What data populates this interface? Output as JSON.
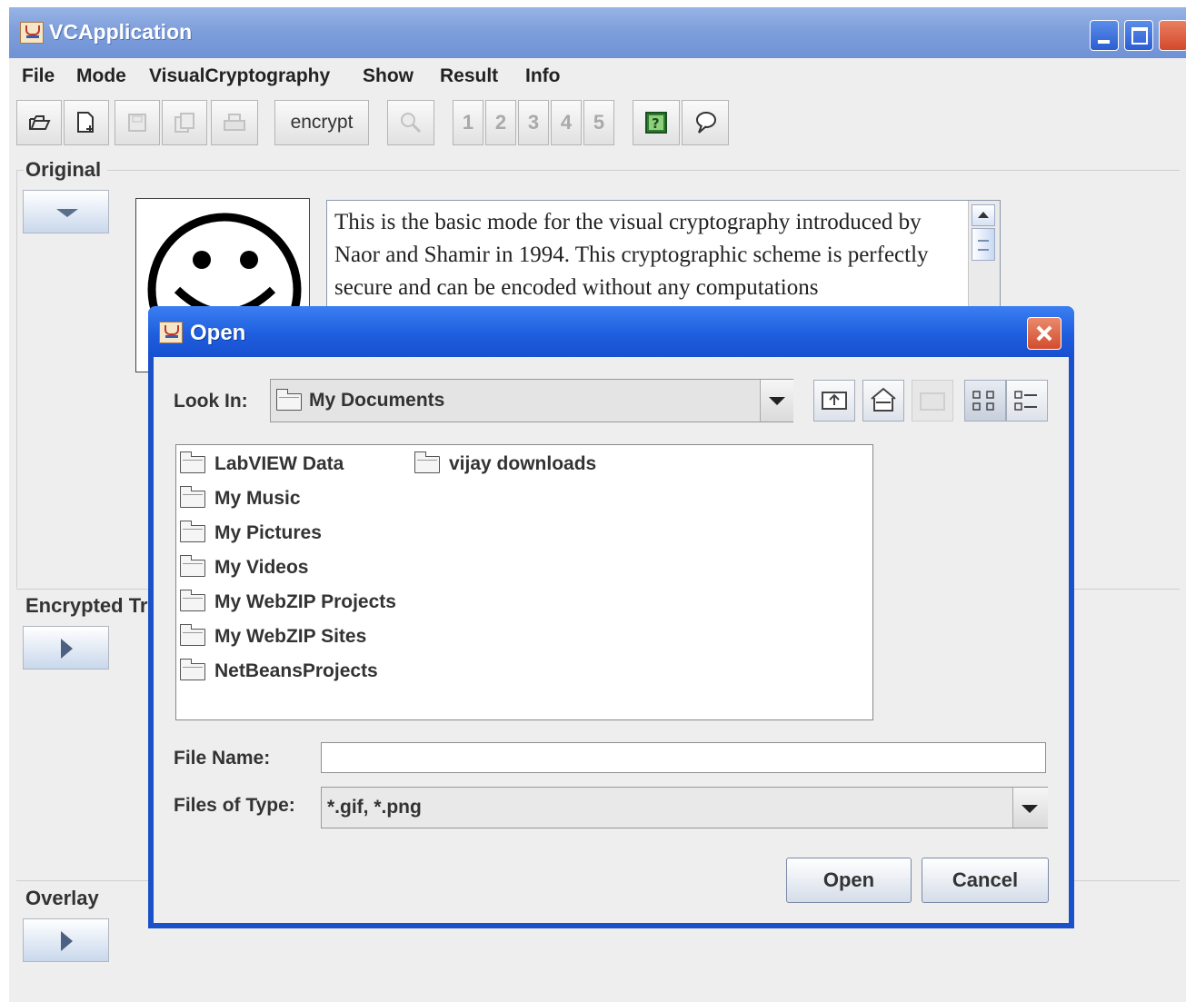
{
  "app": {
    "title": "VCApplication",
    "menu": [
      "File",
      "Mode",
      "VisualCryptography",
      "Show",
      "Result",
      "Info"
    ],
    "toolbar": {
      "encrypt_label": "encrypt",
      "share_numbers": [
        "1",
        "2",
        "3",
        "4",
        "5"
      ]
    },
    "panels": {
      "original": "Original",
      "encrypted": "Encrypted Tr",
      "overlay": "Overlay"
    },
    "description": "This is the basic mode for the visual cryptography introduced by Naor and Shamir in 1994. This cryptographic scheme is perfectly secure and can be encoded without any computations"
  },
  "dialog": {
    "title": "Open",
    "look_in_label": "Look In:",
    "look_in_value": "My Documents",
    "files": [
      "LabVIEW Data",
      "My Music",
      "My Pictures",
      "My Videos",
      "My WebZIP Projects",
      "My WebZIP Sites",
      "NetBeansProjects",
      "vijay downloads"
    ],
    "file_name_label": "File Name:",
    "file_name_value": "",
    "file_type_label": "Files of Type:",
    "file_type_value": "*.gif, *.png",
    "open_button": "Open",
    "cancel_button": "Cancel"
  },
  "colors": {
    "dialog_frame": "#1a50c8",
    "title_bar": "#7f9fdb",
    "close_button": "#d84f31"
  }
}
